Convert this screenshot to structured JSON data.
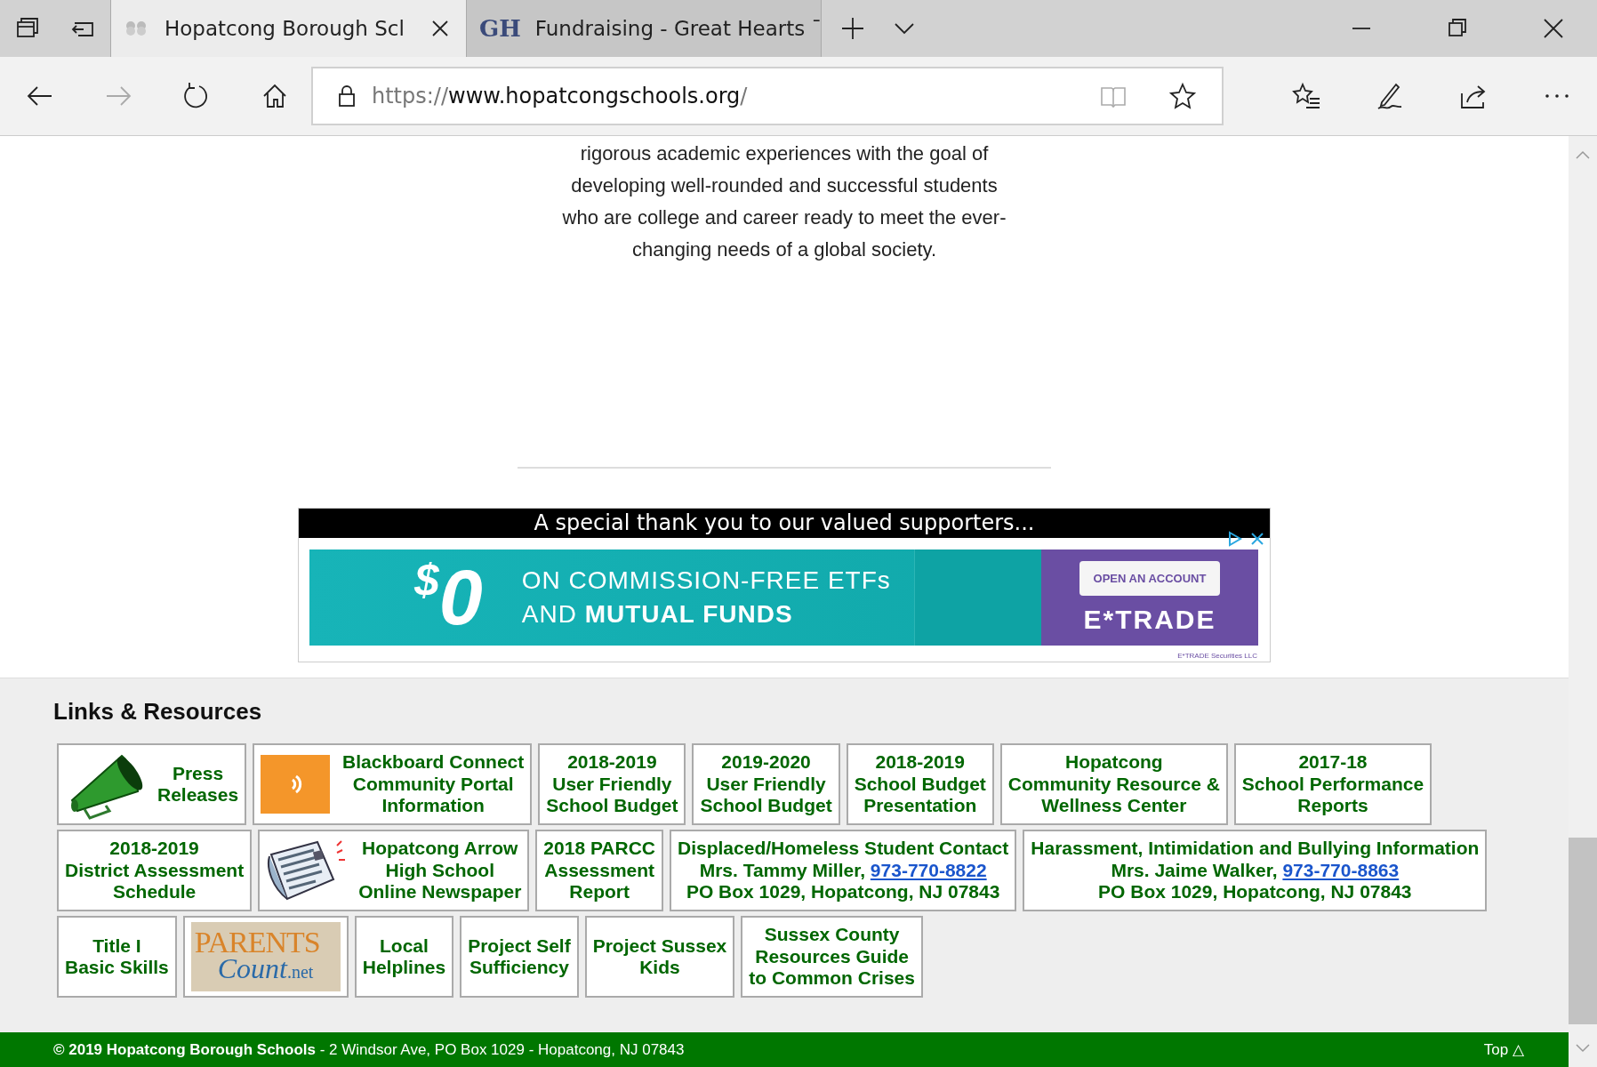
{
  "browser": {
    "tabs": [
      {
        "title": "Hopatcong Borough Scl",
        "selected": true
      },
      {
        "title": "Fundraising - Great Hearts ˉ",
        "selected": false,
        "favicon": "GH"
      }
    ],
    "address": {
      "scheme": "https://",
      "host": "www.hopatcongschools.org",
      "path": "/"
    },
    "forward_disabled": true
  },
  "mission": {
    "lines": [
      "rigorous academic experiences with the goal of",
      "developing well-rounded and successful students",
      "who are college and career ready to meet the ever-",
      "changing needs of a global society."
    ]
  },
  "supporters": {
    "heading": "A special thank you to our valued supporters...",
    "ad": {
      "amount_symbol": "$",
      "amount": "0",
      "line1": "ON COMMISSION-FREE ETFs",
      "line2": "AND **MUTUAL FUNDS**",
      "button": "OPEN AN ACCOUNT",
      "brand": "E*TRADE",
      "fineprint": "E*TRADE Securities LLC"
    }
  },
  "links": {
    "heading": "Links & Resources",
    "tiles": [
      {
        "kind": "megaphone",
        "lines": [
          {
            "text": "Press"
          },
          {
            "text": "Releases"
          }
        ]
      },
      {
        "kind": "speaker",
        "lines": [
          {
            "text": "Blackboard Connect"
          },
          {
            "text": "Community Portal"
          },
          {
            "text": "Information"
          }
        ]
      },
      {
        "kind": "text",
        "lines": [
          {
            "text": "2018-2019"
          },
          {
            "text": "User Friendly"
          },
          {
            "text": "School Budget"
          }
        ]
      },
      {
        "kind": "text",
        "lines": [
          {
            "text": "2019-2020"
          },
          {
            "text": "User Friendly"
          },
          {
            "text": "School Budget"
          }
        ]
      },
      {
        "kind": "text",
        "lines": [
          {
            "text": "2018-2019"
          },
          {
            "text": "School Budget"
          },
          {
            "text": "Presentation"
          }
        ]
      },
      {
        "kind": "text",
        "lines": [
          {
            "text": "Hopatcong"
          },
          {
            "text": "Community Resource &"
          },
          {
            "text": "Wellness Center"
          }
        ]
      },
      {
        "kind": "text",
        "lines": [
          {
            "text": "2017-18"
          },
          {
            "text": "School Performance"
          },
          {
            "text": "Reports"
          }
        ]
      },
      {
        "kind": "text",
        "lines": [
          {
            "text": "2018-2019"
          },
          {
            "text": "District Assessment"
          },
          {
            "text": "Schedule"
          }
        ]
      },
      {
        "kind": "newspaper",
        "lines": [
          {
            "text": "Hopatcong Arrow"
          },
          {
            "text": "High School"
          },
          {
            "text": "Online Newspaper"
          }
        ]
      },
      {
        "kind": "text",
        "lines": [
          {
            "text": "2018 PARCC"
          },
          {
            "text": "Assessment"
          },
          {
            "text": "Report"
          }
        ]
      },
      {
        "kind": "text",
        "lines": [
          {
            "text": "Displaced/Homeless Student Contact"
          },
          {
            "text": "Mrs. Tammy Miller,",
            "link": "973-770-8822"
          },
          {
            "text": "PO Box 1029, Hopatcong, NJ 07843"
          }
        ]
      },
      {
        "kind": "text",
        "lines": [
          {
            "text": "Harassment, Intimidation and Bullying Information"
          },
          {
            "text": "Mrs. Jaime Walker,",
            "link": "973-770-8863"
          },
          {
            "text": "PO Box 1029, Hopatcong, NJ 07843"
          }
        ]
      },
      {
        "kind": "text",
        "lines": [
          {
            "text": "Title I"
          },
          {
            "text": "Basic Skills"
          }
        ]
      },
      {
        "kind": "logo",
        "logo": [
          "PARENTS",
          "Count",
          ".net"
        ]
      },
      {
        "kind": "text",
        "lines": [
          {
            "text": "Local"
          },
          {
            "text": "Helplines"
          }
        ]
      },
      {
        "kind": "text",
        "lines": [
          {
            "text": "Project Self"
          },
          {
            "text": "Sufficiency"
          }
        ]
      },
      {
        "kind": "text",
        "lines": [
          {
            "text": "Project Sussex"
          },
          {
            "text": "Kids"
          }
        ]
      },
      {
        "kind": "text",
        "lines": [
          {
            "text": "Sussex County"
          },
          {
            "text": "Resources Guide"
          },
          {
            "text": "to Common Crises"
          }
        ]
      }
    ]
  },
  "footer": {
    "text": "**© 2019 Hopatcong Borough Schools** - 2 Windsor Ave, PO Box 1029 - Hopatcong, NJ 07843",
    "top_link": "Top △"
  }
}
